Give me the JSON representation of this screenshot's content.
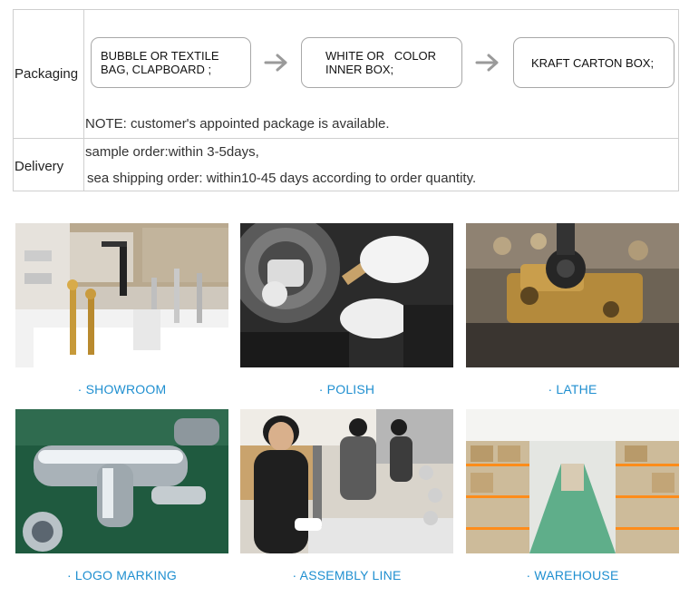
{
  "info": {
    "packaging_label": "Packaging",
    "delivery_label": "Delivery",
    "steps": [
      "BUBBLE OR TEXTILE BAG, CLAPBOARD ;",
      "WHITE OR   COLOR INNER BOX;",
      "KRAFT CARTON BOX;"
    ],
    "arrow_icon": "right-arrow-icon",
    "note": "NOTE: customer's appointed package is available.",
    "delivery_lines": [
      "sample order:within 3-5days,",
      "sea shipping order: within10-45 days according to order quantity."
    ]
  },
  "gallery": [
    {
      "caption": "· SHOWROOM"
    },
    {
      "caption": "· POLISH"
    },
    {
      "caption": "· LATHE"
    },
    {
      "caption": "· LOGO MARKING"
    },
    {
      "caption": "· ASSEMBLY LINE"
    },
    {
      "caption": "· WAREHOUSE"
    }
  ],
  "colors": {
    "caption": "#1f8fd0",
    "border": "#cfcfcf",
    "arrow": "#9a9a9a"
  }
}
